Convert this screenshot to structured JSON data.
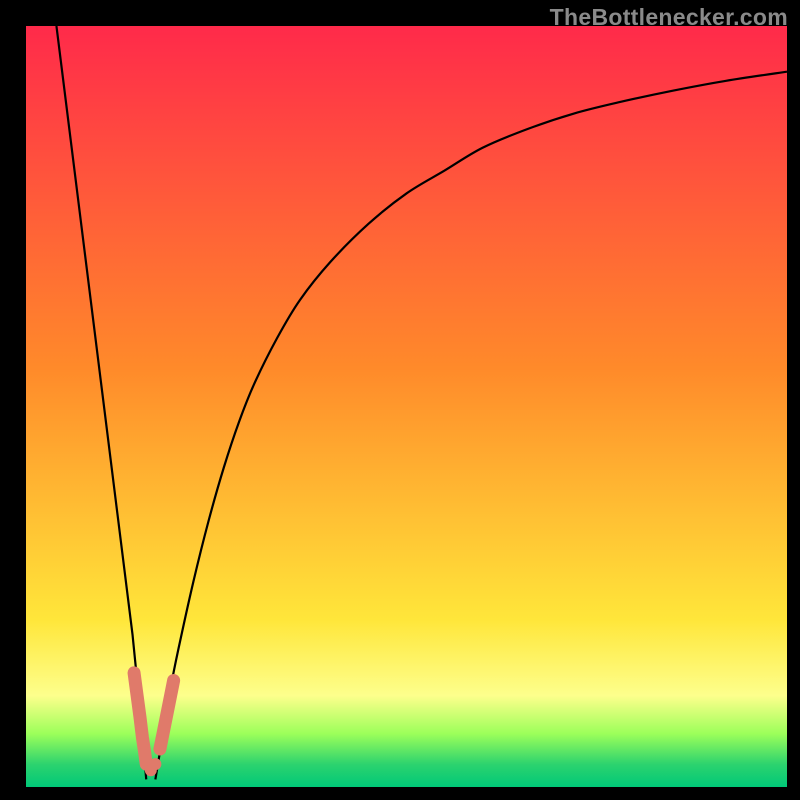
{
  "watermark": "TheBottlenecker.com",
  "colors": {
    "top": "#ff2a4a",
    "mid1": "#ff8a2a",
    "mid2": "#ffe63a",
    "band": "#fdff8c",
    "green1": "#9cff5a",
    "green2": "#2dd36e",
    "green3": "#00c878",
    "curve": "#000000",
    "marker": "#e07a6a",
    "frame": "#000000"
  },
  "chart_data": {
    "type": "line",
    "title": "",
    "xlabel": "",
    "ylabel": "",
    "xlim": [
      0,
      100
    ],
    "ylim": [
      0,
      100
    ],
    "series": [
      {
        "name": "left-curve",
        "x": [
          4,
          5,
          6,
          7,
          8,
          9,
          10,
          11,
          12,
          13,
          14,
          15,
          15.8
        ],
        "values": [
          100,
          92,
          84,
          76,
          68,
          60,
          52,
          44,
          36,
          28,
          20,
          10,
          1
        ]
      },
      {
        "name": "right-curve",
        "x": [
          17,
          18,
          19,
          20,
          22,
          24,
          26,
          28,
          30,
          33,
          36,
          40,
          45,
          50,
          55,
          60,
          66,
          72,
          78,
          85,
          92,
          100
        ],
        "values": [
          1,
          7,
          13,
          18,
          27,
          35,
          42,
          48,
          53,
          59,
          64,
          69,
          74,
          78,
          81,
          84,
          86.5,
          88.5,
          90,
          91.5,
          92.8,
          94
        ]
      }
    ],
    "markers": [
      {
        "x": 14.2,
        "y": 15
      },
      {
        "x": 14.6,
        "y": 12
      },
      {
        "x": 15.0,
        "y": 9
      },
      {
        "x": 15.3,
        "y": 6.5
      },
      {
        "x": 15.6,
        "y": 4.5
      },
      {
        "x": 15.8,
        "y": 3
      },
      {
        "x": 16.4,
        "y": 2.2
      },
      {
        "x": 17.0,
        "y": 3
      },
      {
        "x": 17.6,
        "y": 5
      },
      {
        "x": 18.2,
        "y": 8
      },
      {
        "x": 18.8,
        "y": 11
      },
      {
        "x": 19.4,
        "y": 14
      }
    ]
  }
}
